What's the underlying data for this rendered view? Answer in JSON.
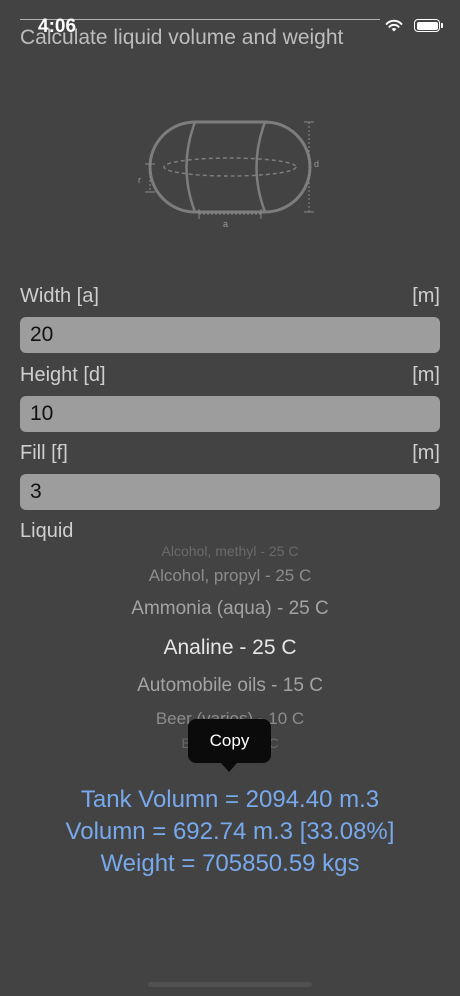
{
  "status": {
    "time": "4:06"
  },
  "page": {
    "title": "Calculate liquid volume and weight"
  },
  "diagram": {
    "label_r": "r",
    "label_d": "d",
    "label_a": "a",
    "stroke_color": "#7d7d7d"
  },
  "fields": {
    "width": {
      "label": "Width [a]",
      "unit": "[m]",
      "value": "20"
    },
    "height": {
      "label": "Height [d]",
      "unit": "[m]",
      "value": "10"
    },
    "fill": {
      "label": "Fill [f]",
      "unit": "[m]",
      "value": "3"
    }
  },
  "liquid": {
    "label": "Liquid",
    "options": [
      "Alcohol, methyl - 25 C",
      "Alcohol, propyl - 25 C",
      "Ammonia (aqua) - 25 C",
      "Analine - 25 C",
      "Automobile oils - 15 C",
      "Beer (varios) - 10 C",
      "Benzene - 15 C"
    ],
    "selected": "Analine - 25 C"
  },
  "tooltip": {
    "label": "Copy"
  },
  "results": {
    "tank_volume": "Tank Volumn = 2094.40 m.3",
    "volume": "Volumn = 692.74 m.3 [33.08%]",
    "weight": "Weight = 705850.59 kgs",
    "color": "#78a9ec"
  }
}
